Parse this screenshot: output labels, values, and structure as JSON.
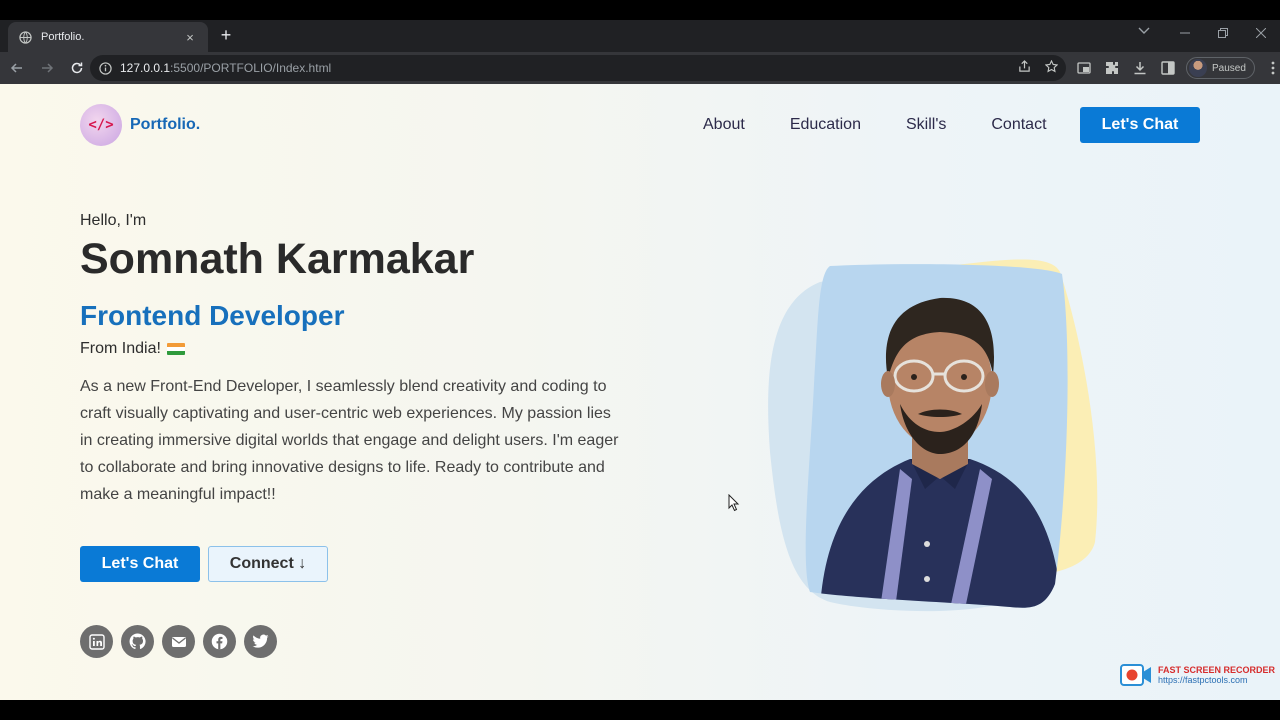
{
  "browser": {
    "tab_title": "Portfolio.",
    "tab_close": "×",
    "new_tab": "+",
    "url_host": "127.0.0.1",
    "url_rest": ":5500/PORTFOLIO/Index.html",
    "profile_status": "Paused"
  },
  "nav": {
    "logo_text": "Portfolio.",
    "logo_glyph": "</>",
    "items": [
      "About",
      "Education",
      "Skill's",
      "Contact"
    ],
    "cta": "Let's Chat"
  },
  "hero": {
    "greeting": "Hello, I'm",
    "name": "Somnath Karmakar",
    "role": "Frontend Developer",
    "from": "From India!",
    "bio": "As a new Front-End Developer, I seamlessly blend creativity and coding to craft visually captivating and user-centric web experiences. My passion lies in creating immersive digital worlds that engage and delight users. I'm eager to collaborate and bring innovative designs to life. Ready to contribute and make a meaningful impact!!",
    "btn_chat": "Let's Chat",
    "btn_connect": "Connect ↓",
    "socials": [
      "linkedin-icon",
      "github-icon",
      "mail-icon",
      "facebook-icon",
      "twitter-icon"
    ]
  },
  "watermark": {
    "title": "FAST SCREEN RECORDER",
    "url": "https://fastpctools.com"
  },
  "colors": {
    "accent": "#0a7ad6",
    "role": "#1770bc",
    "social": "#6e6e6e"
  }
}
